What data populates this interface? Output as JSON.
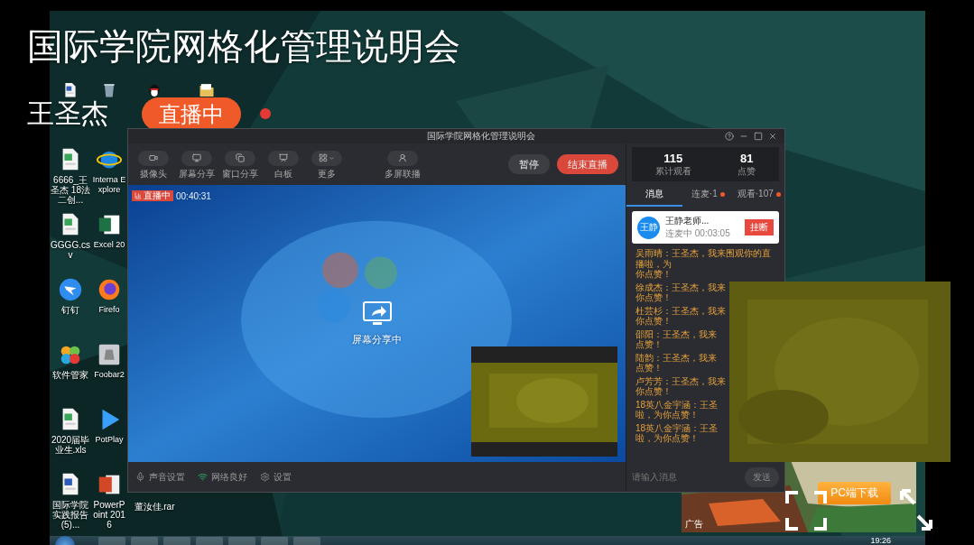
{
  "overlay": {
    "title": "国际学院网格化管理说明会",
    "presenter": "王圣杰",
    "live_badge": "直播中"
  },
  "desktop": {
    "rows": [
      [
        {
          "kind": "word"
        },
        {
          "kind": "recycle"
        },
        {
          "kind": "qq"
        },
        {
          "kind": "folder"
        }
      ],
      [
        {
          "kind": "sheet",
          "label": "6666_王圣杰 18法二创..."
        },
        {
          "kind": "ie",
          "label": "Interna Explore"
        }
      ],
      [
        {
          "kind": "sheet",
          "label": "GGGG.csv"
        },
        {
          "kind": "excel",
          "label": "Excel 20"
        }
      ],
      [
        {
          "kind": "dingtalk",
          "label": "钉钉"
        },
        {
          "kind": "firefox",
          "label": "Firefo"
        }
      ],
      [
        {
          "kind": "manager",
          "label": "软件管家"
        },
        {
          "kind": "foobar",
          "label": "Foobar2"
        }
      ],
      [
        {
          "kind": "sheet",
          "label": "2020届毕业生.xls"
        },
        {
          "kind": "player",
          "label": "PotPlay"
        }
      ],
      [
        {
          "kind": "word",
          "label": "国际学院实践报告(5)..."
        },
        {
          "kind": "powerpoint",
          "label": "PowerPoint 2016"
        },
        {
          "kind": "hidden",
          "label": "董汝佳.rar"
        }
      ]
    ]
  },
  "app": {
    "title": "国际学院网格化管理说明会",
    "toolbar": [
      {
        "kind": "camera",
        "label": "摄像头"
      },
      {
        "kind": "screen",
        "label": "屏幕分享"
      },
      {
        "kind": "window",
        "label": "窗口分享"
      },
      {
        "kind": "board",
        "label": "白板"
      },
      {
        "kind": "more",
        "label": "更多"
      },
      {
        "kind": "multi",
        "label": "多屏联播"
      }
    ],
    "actions": [
      {
        "kind": "pause",
        "label": "暂停"
      },
      {
        "kind": "end",
        "label": "结束直播"
      }
    ],
    "live_tag": "直播中",
    "timer": "00:40:31",
    "share_status": "屏幕分享中",
    "footer": [
      {
        "kind": "mic",
        "label": "声音设置"
      },
      {
        "kind": "wifi",
        "label": "网络良好"
      },
      {
        "kind": "gear",
        "label": "设置"
      }
    ],
    "stats": [
      {
        "value": "115",
        "label": "累计观看"
      },
      {
        "value": "81",
        "label": "点赞"
      }
    ],
    "tabs": [
      {
        "label": "消息",
        "selected": true,
        "alert": false
      },
      {
        "label": "连麦·1",
        "selected": false,
        "alert": true
      },
      {
        "label": "观看·107",
        "selected": false,
        "alert": true
      }
    ],
    "call": {
      "avatar": "王静",
      "name": "王静老师...",
      "status": "连麦中 00:03:05",
      "button": "挂断"
    },
    "messages": [
      {
        "lines": [
          "吴雨晴：王圣杰，我来围观你的直播啦，为",
          "你点赞！"
        ]
      },
      {
        "lines": [
          "徐成杰：王圣杰，我来",
          "你点赞！"
        ]
      },
      {
        "lines": [
          "杜芸杉：王圣杰，我来",
          "你点赞！"
        ]
      },
      {
        "lines": [
          "邵阳：王圣杰，我来",
          "点赞！"
        ]
      },
      {
        "lines": [
          "陆韵：王圣杰，我来",
          "点赞！"
        ]
      },
      {
        "lines": [
          "卢芳芳：王圣杰，我来",
          "你点赞！"
        ]
      },
      {
        "lines": [
          "18英八金宇涵：王圣",
          "啦，为你点赞！"
        ]
      },
      {
        "lines": [
          "18英八金宇涵：王圣",
          "啦，为你点赞！"
        ]
      }
    ],
    "input": {
      "placeholder": "请输入消息"
    },
    "send": "发送"
  },
  "ad": {
    "button": "PC端下载",
    "label": "广告"
  },
  "taskbar": {
    "clock": "19:26"
  }
}
